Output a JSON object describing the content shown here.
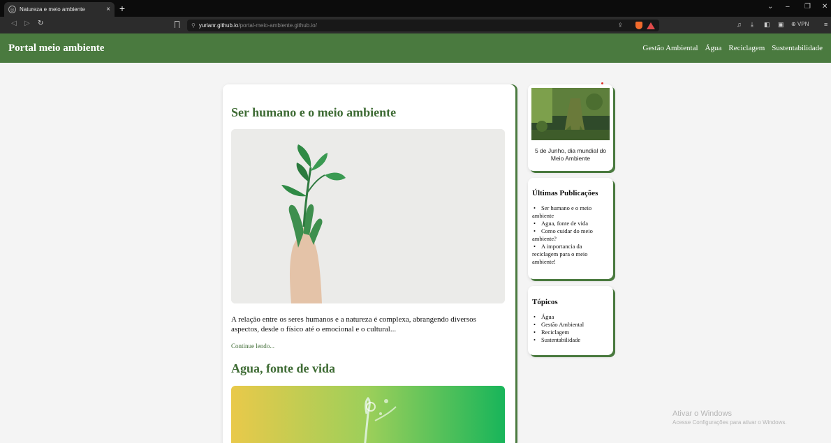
{
  "browser": {
    "tab_title": "Natureza e meio ambiente",
    "tab_close": "×",
    "new_tab": "+",
    "url_host": "yurianr.github.io",
    "url_path": "/portal-meio-ambiente.github.io/",
    "vpn_label": "⊕ VPN"
  },
  "site": {
    "title": "Portal meio ambiente",
    "nav": [
      "Gestão Ambiental",
      "Água",
      "Reciclagem",
      "Sustentabilidade"
    ]
  },
  "posts": [
    {
      "title": "Ser humano e o meio ambiente",
      "excerpt": "A relação entre os seres humanos e a natureza é complexa, abrangendo diversos aspectos, desde o físico até o emocional e o cultural...",
      "read_more": "Continue lendo..."
    },
    {
      "title": "Agua, fonte de vida"
    }
  ],
  "sidebar": {
    "featured_caption": "5 de Junho, dia mundial do Meio Ambiente",
    "latest_title": "Últimas Publicações",
    "latest_items": [
      "Ser humano e o meio ambiente",
      "Agua, fonte de vida",
      "Como cuidar do meio ambiente?",
      "A importancia da reciclagem para o meio ambiente!"
    ],
    "topics_title": "Tópicos",
    "topics_items": [
      "Água",
      "Gestão Ambiental",
      "Reciclagem",
      "Sustentabilidade"
    ]
  },
  "watermark": {
    "line1": "Ativar o Windows",
    "line2": "Acesse Configurações para ativar o Windows."
  },
  "colors": {
    "header_green": "#4a7a3f",
    "title_green": "#3e6b34",
    "page_bg": "#f4f4f4"
  }
}
